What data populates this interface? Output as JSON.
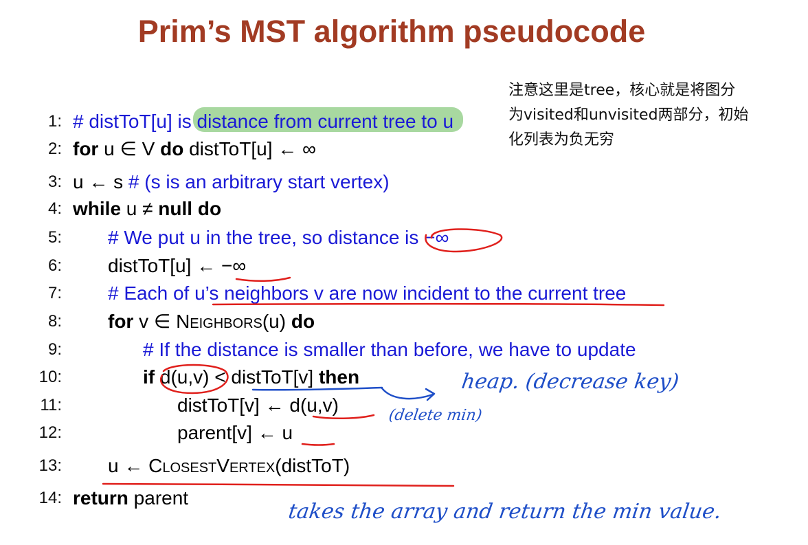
{
  "title": "Prim’s MST algorithm pseudocode",
  "note": {
    "line1": "注意这里是tree，核心就是将图分",
    "line2": "为visited和unvisited两部分，初始",
    "line3": "化列表为负无穷"
  },
  "lines": [
    {
      "num": "1:",
      "comment": "# distToT[u] is distance from current tree to u"
    },
    {
      "num": "2:",
      "kw1": "for",
      "mid": " u ∈ V ",
      "kw2": "do",
      "rest": " distToT[u] ← ∞"
    },
    {
      "num": "3:",
      "code": "u ← s ",
      "comment": "# (s is an arbitrary start vertex)"
    },
    {
      "num": "4:",
      "kw1": "while",
      "mid": " u ≠ ",
      "kw2": "null do"
    },
    {
      "num": "5:",
      "comment": "# We put u in the tree, so distance is −∞"
    },
    {
      "num": "6:",
      "code": "distToT[u] ← −∞"
    },
    {
      "num": "7:",
      "comment": "# Each of u’s neighbors v are now incident to the current tree"
    },
    {
      "num": "8:",
      "kw1": "for",
      "mid": " v ∈ ",
      "sc": "Neighbors",
      "after": "(u) ",
      "kw2": "do"
    },
    {
      "num": "9:",
      "comment": "# If the distance is smaller than before, we have to update"
    },
    {
      "num": "10:",
      "kw1": "if",
      "mid": " d(u,v) < distToT[v] ",
      "kw2": "then"
    },
    {
      "num": "11:",
      "code": "distToT[v] ← d(u,v)"
    },
    {
      "num": "12:",
      "code": "parent[v] ← u"
    },
    {
      "num": "13:",
      "pre": "u ← ",
      "sc": "ClosestVertex",
      "after": "(distToT)"
    },
    {
      "num": "14:",
      "kw1": "return",
      "rest": " parent"
    }
  ],
  "handwriting": {
    "heap": "heap. (decrease key)",
    "delete": "(delete min)",
    "bottom": "takes the array and return the min value."
  },
  "colors": {
    "title": "#a23b23",
    "comment": "#1a1ad6",
    "highlight": "#a8d8a0",
    "red_ink": "#e0201c",
    "blue_ink": "#1f4fc8"
  }
}
